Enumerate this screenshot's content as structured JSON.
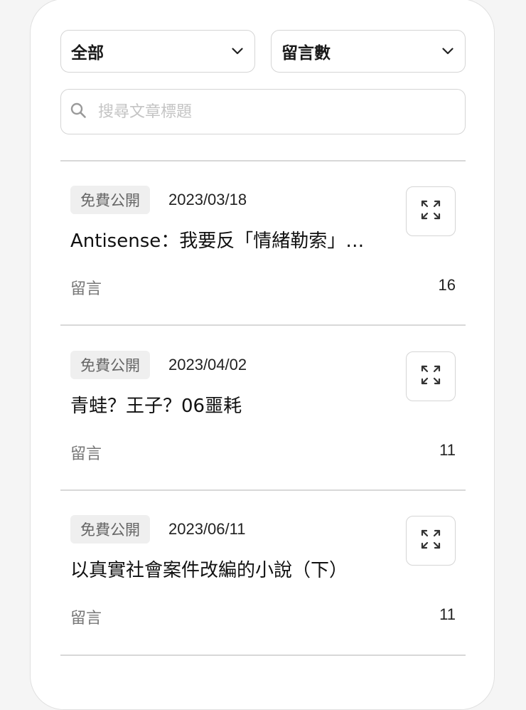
{
  "filters": {
    "category": {
      "selected": "全部"
    },
    "sort": {
      "selected": "留言數"
    }
  },
  "search": {
    "placeholder": "搜尋文章標題",
    "value": ""
  },
  "posts": [
    {
      "badge": "免費公開",
      "date": "2023/03/18",
      "title": "Antisense：我要反「情緒勒索」…",
      "comment_label": "留言",
      "comment_count": "16"
    },
    {
      "badge": "免費公開",
      "date": "2023/04/02",
      "title": "青蛙？王子？06噩耗",
      "comment_label": "留言",
      "comment_count": "11"
    },
    {
      "badge": "免費公開",
      "date": "2023/06/11",
      "title": "以真實社會案件改編的小說（下）",
      "comment_label": "留言",
      "comment_count": "11"
    }
  ],
  "icons": {
    "select_arrow": "chevron-down-icon",
    "search": "search-icon",
    "expand": "expand-icon"
  }
}
